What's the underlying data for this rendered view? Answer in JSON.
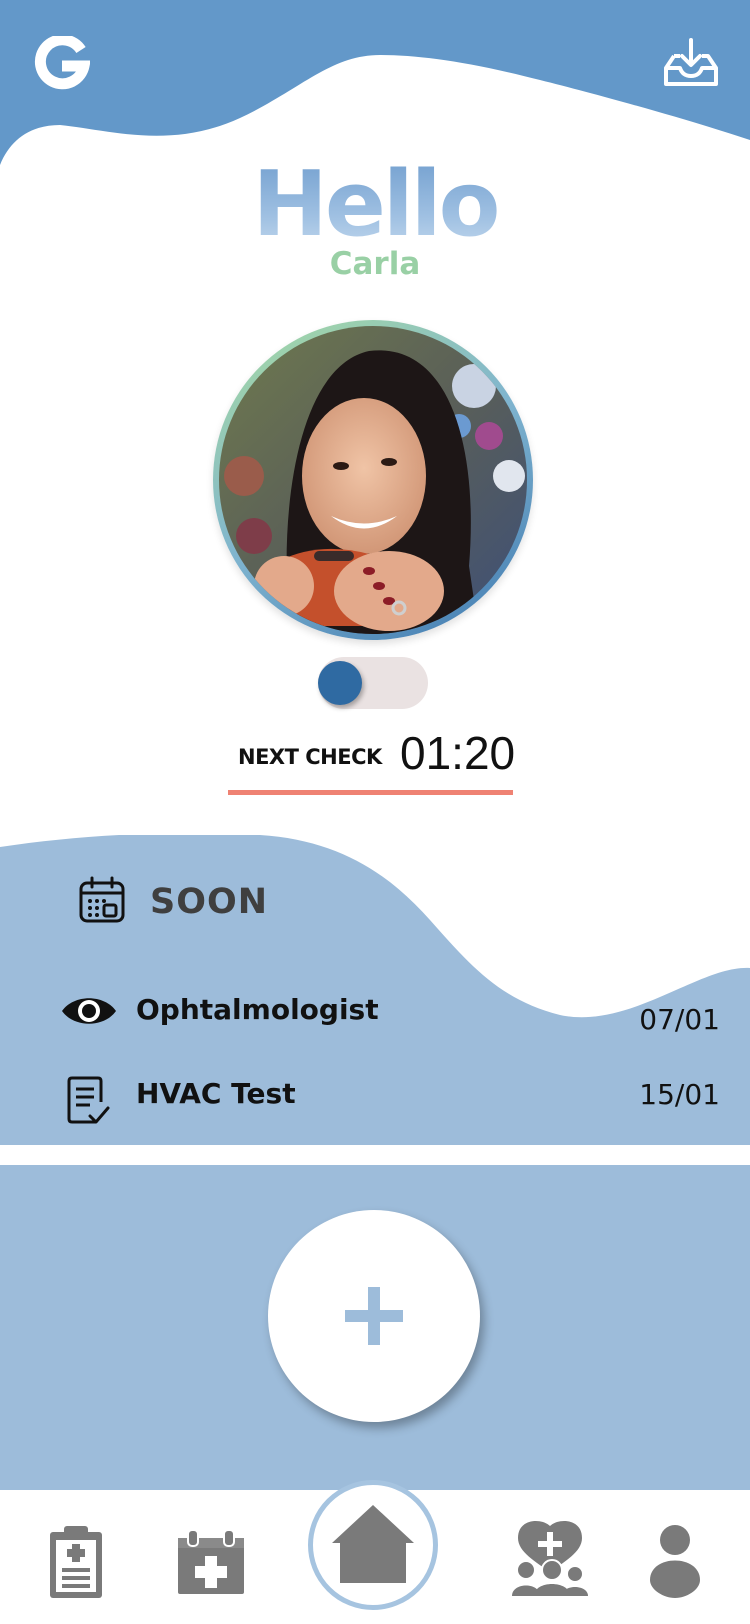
{
  "header": {
    "logo_letter": "G",
    "inbox_icon": "inbox-download-icon",
    "brand_color": "#6398c9"
  },
  "greeting": {
    "hello": "Hello",
    "name": "Carla"
  },
  "status": {
    "toggle_on": false,
    "next_check_label": "NEXT CHECK",
    "next_check_time": "01:20"
  },
  "soon": {
    "title": "SOON",
    "icon": "calendar-icon",
    "items": [
      {
        "icon": "eye-icon",
        "name": "Ophtalmologist",
        "date": "07/01"
      },
      {
        "icon": "checklist-icon",
        "name": "HVAC Test",
        "date": "15/01"
      }
    ]
  },
  "add_button": {
    "icon": "plus-icon"
  },
  "nav": {
    "items": [
      {
        "icon": "clipboard-icon"
      },
      {
        "icon": "medical-calendar-icon"
      },
      {
        "icon": "home-icon",
        "active": true
      },
      {
        "icon": "family-health-icon"
      },
      {
        "icon": "user-icon"
      }
    ]
  },
  "colors": {
    "accent_blue": "#6398c9",
    "light_blue": "#9dbcda",
    "green": "#99d0a5",
    "underline": "#ef8273",
    "toggle_knob": "#2f6aa2"
  }
}
